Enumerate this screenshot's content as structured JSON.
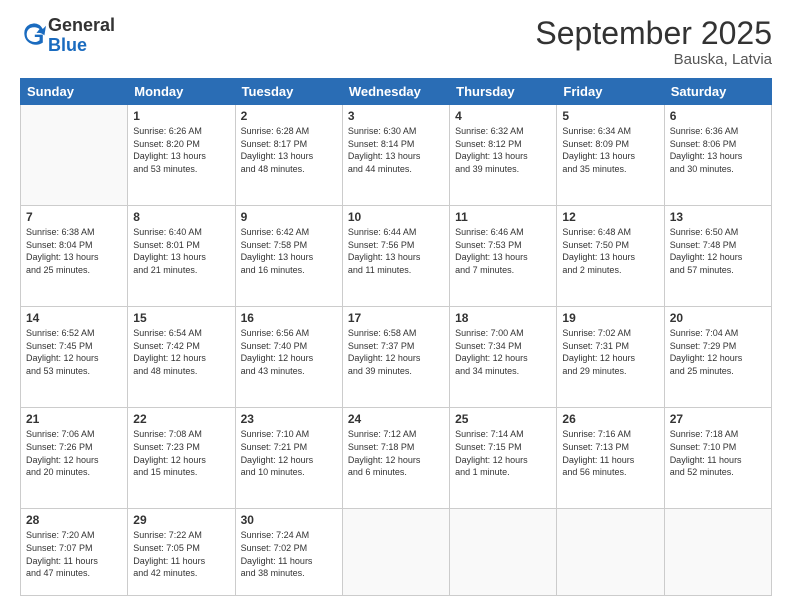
{
  "logo": {
    "general": "General",
    "blue": "Blue"
  },
  "header": {
    "title": "September 2025",
    "subtitle": "Bauska, Latvia"
  },
  "weekdays": [
    "Sunday",
    "Monday",
    "Tuesday",
    "Wednesday",
    "Thursday",
    "Friday",
    "Saturday"
  ],
  "weeks": [
    [
      {
        "day": "",
        "info": ""
      },
      {
        "day": "1",
        "info": "Sunrise: 6:26 AM\nSunset: 8:20 PM\nDaylight: 13 hours\nand 53 minutes."
      },
      {
        "day": "2",
        "info": "Sunrise: 6:28 AM\nSunset: 8:17 PM\nDaylight: 13 hours\nand 48 minutes."
      },
      {
        "day": "3",
        "info": "Sunrise: 6:30 AM\nSunset: 8:14 PM\nDaylight: 13 hours\nand 44 minutes."
      },
      {
        "day": "4",
        "info": "Sunrise: 6:32 AM\nSunset: 8:12 PM\nDaylight: 13 hours\nand 39 minutes."
      },
      {
        "day": "5",
        "info": "Sunrise: 6:34 AM\nSunset: 8:09 PM\nDaylight: 13 hours\nand 35 minutes."
      },
      {
        "day": "6",
        "info": "Sunrise: 6:36 AM\nSunset: 8:06 PM\nDaylight: 13 hours\nand 30 minutes."
      }
    ],
    [
      {
        "day": "7",
        "info": "Sunrise: 6:38 AM\nSunset: 8:04 PM\nDaylight: 13 hours\nand 25 minutes."
      },
      {
        "day": "8",
        "info": "Sunrise: 6:40 AM\nSunset: 8:01 PM\nDaylight: 13 hours\nand 21 minutes."
      },
      {
        "day": "9",
        "info": "Sunrise: 6:42 AM\nSunset: 7:58 PM\nDaylight: 13 hours\nand 16 minutes."
      },
      {
        "day": "10",
        "info": "Sunrise: 6:44 AM\nSunset: 7:56 PM\nDaylight: 13 hours\nand 11 minutes."
      },
      {
        "day": "11",
        "info": "Sunrise: 6:46 AM\nSunset: 7:53 PM\nDaylight: 13 hours\nand 7 minutes."
      },
      {
        "day": "12",
        "info": "Sunrise: 6:48 AM\nSunset: 7:50 PM\nDaylight: 13 hours\nand 2 minutes."
      },
      {
        "day": "13",
        "info": "Sunrise: 6:50 AM\nSunset: 7:48 PM\nDaylight: 12 hours\nand 57 minutes."
      }
    ],
    [
      {
        "day": "14",
        "info": "Sunrise: 6:52 AM\nSunset: 7:45 PM\nDaylight: 12 hours\nand 53 minutes."
      },
      {
        "day": "15",
        "info": "Sunrise: 6:54 AM\nSunset: 7:42 PM\nDaylight: 12 hours\nand 48 minutes."
      },
      {
        "day": "16",
        "info": "Sunrise: 6:56 AM\nSunset: 7:40 PM\nDaylight: 12 hours\nand 43 minutes."
      },
      {
        "day": "17",
        "info": "Sunrise: 6:58 AM\nSunset: 7:37 PM\nDaylight: 12 hours\nand 39 minutes."
      },
      {
        "day": "18",
        "info": "Sunrise: 7:00 AM\nSunset: 7:34 PM\nDaylight: 12 hours\nand 34 minutes."
      },
      {
        "day": "19",
        "info": "Sunrise: 7:02 AM\nSunset: 7:31 PM\nDaylight: 12 hours\nand 29 minutes."
      },
      {
        "day": "20",
        "info": "Sunrise: 7:04 AM\nSunset: 7:29 PM\nDaylight: 12 hours\nand 25 minutes."
      }
    ],
    [
      {
        "day": "21",
        "info": "Sunrise: 7:06 AM\nSunset: 7:26 PM\nDaylight: 12 hours\nand 20 minutes."
      },
      {
        "day": "22",
        "info": "Sunrise: 7:08 AM\nSunset: 7:23 PM\nDaylight: 12 hours\nand 15 minutes."
      },
      {
        "day": "23",
        "info": "Sunrise: 7:10 AM\nSunset: 7:21 PM\nDaylight: 12 hours\nand 10 minutes."
      },
      {
        "day": "24",
        "info": "Sunrise: 7:12 AM\nSunset: 7:18 PM\nDaylight: 12 hours\nand 6 minutes."
      },
      {
        "day": "25",
        "info": "Sunrise: 7:14 AM\nSunset: 7:15 PM\nDaylight: 12 hours\nand 1 minute."
      },
      {
        "day": "26",
        "info": "Sunrise: 7:16 AM\nSunset: 7:13 PM\nDaylight: 11 hours\nand 56 minutes."
      },
      {
        "day": "27",
        "info": "Sunrise: 7:18 AM\nSunset: 7:10 PM\nDaylight: 11 hours\nand 52 minutes."
      }
    ],
    [
      {
        "day": "28",
        "info": "Sunrise: 7:20 AM\nSunset: 7:07 PM\nDaylight: 11 hours\nand 47 minutes."
      },
      {
        "day": "29",
        "info": "Sunrise: 7:22 AM\nSunset: 7:05 PM\nDaylight: 11 hours\nand 42 minutes."
      },
      {
        "day": "30",
        "info": "Sunrise: 7:24 AM\nSunset: 7:02 PM\nDaylight: 11 hours\nand 38 minutes."
      },
      {
        "day": "",
        "info": ""
      },
      {
        "day": "",
        "info": ""
      },
      {
        "day": "",
        "info": ""
      },
      {
        "day": "",
        "info": ""
      }
    ]
  ]
}
